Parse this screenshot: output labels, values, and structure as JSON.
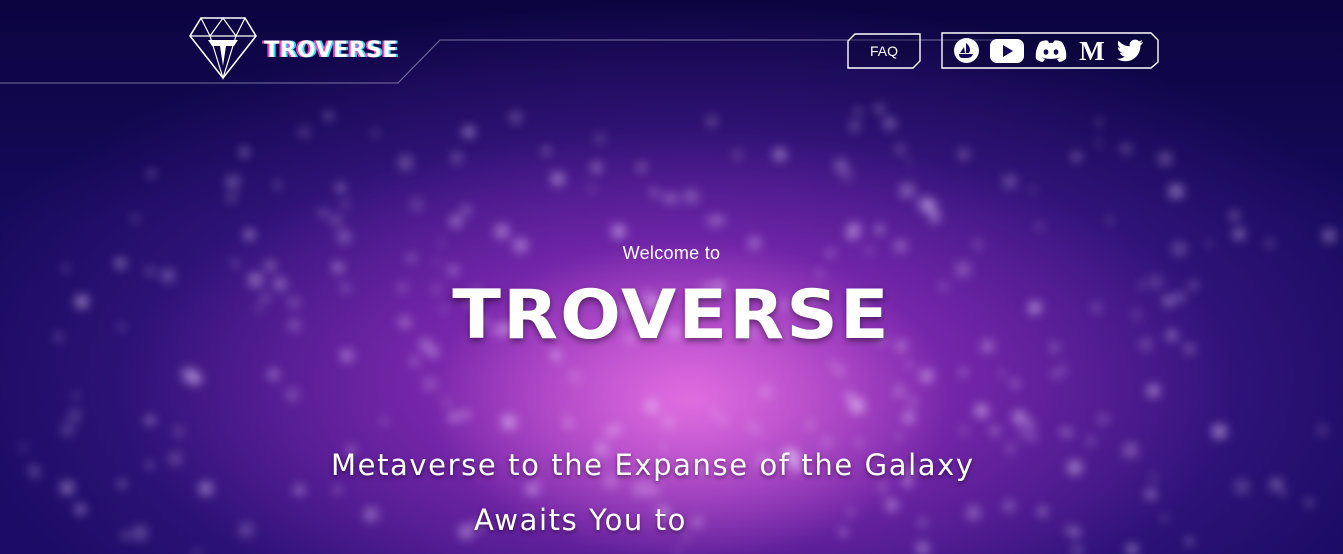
{
  "header": {
    "logo_text": "TROVERSE",
    "faq_label": "FAQ",
    "social_icons": [
      "opensea-icon",
      "youtube-icon",
      "discord-icon",
      "medium-icon",
      "twitter-icon"
    ]
  },
  "hero": {
    "welcome": "Welcome to",
    "title": "TROVERSE",
    "tagline_line1": "Metaverse to the Expanse of the Galaxy",
    "tagline_line2": "Awaits You to"
  },
  "colors": {
    "background_dark": "#0d0640",
    "galaxy_pink": "#d24fd8",
    "galaxy_purple": "#6a2ac0",
    "text": "#ffffff",
    "logo_glitch_pink": "#ff3db8",
    "logo_glitch_cyan": "#2fe0ff"
  }
}
